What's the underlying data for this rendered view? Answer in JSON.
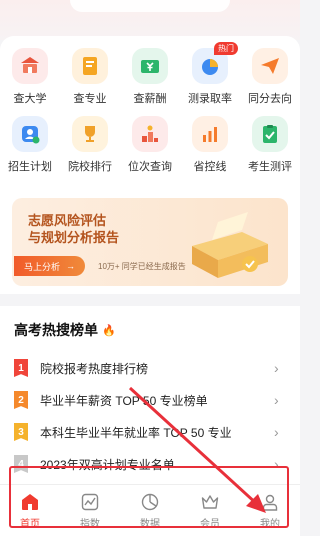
{
  "grid": [
    {
      "label": "查大学",
      "icon": "university-icon",
      "bg": "#fdeaea",
      "fg": "#e8553d"
    },
    {
      "label": "查专业",
      "icon": "book-icon",
      "bg": "#fff1dc",
      "fg": "#f5a623"
    },
    {
      "label": "查薪酬",
      "icon": "salary-icon",
      "bg": "#e4f6ec",
      "fg": "#2cb56b"
    },
    {
      "label": "测录取率",
      "icon": "pie-chart-icon",
      "bg": "#e7f0fd",
      "fg": "#3d8af0",
      "badge": "热门"
    },
    {
      "label": "同分去向",
      "icon": "paper-plane-icon",
      "bg": "#fff0e4",
      "fg": "#f57b2c"
    },
    {
      "label": "招生计划",
      "icon": "user-check-icon",
      "bg": "#e7f0fd",
      "fg": "#3d8af0"
    },
    {
      "label": "院校排行",
      "icon": "trophy-icon",
      "bg": "#fff3dd",
      "fg": "#f0a12a"
    },
    {
      "label": "位次查询",
      "icon": "position-icon",
      "bg": "#fdeaea",
      "fg": "#e8553d"
    },
    {
      "label": "省控线",
      "icon": "bar-chart-icon",
      "bg": "#fff0e4",
      "fg": "#f57b2c"
    },
    {
      "label": "考生测评",
      "icon": "clipboard-icon",
      "bg": "#e4f6ec",
      "fg": "#2cb56b"
    }
  ],
  "banner": {
    "title_line1": "志愿风险评估",
    "title_line2": "与规划分析报告",
    "button_label": "马上分析",
    "note": "10万+ 同学已经生成报告"
  },
  "hot_section": {
    "title": "高考热搜榜单",
    "items": [
      {
        "rank": "1",
        "text": "院校报考热度排行榜",
        "color": "#f0453a"
      },
      {
        "rank": "2",
        "text": "毕业半年薪资 TOP 50 专业榜单",
        "color": "#f5892c"
      },
      {
        "rank": "3",
        "text": "本科生毕业半年就业率 TOP 50 专业",
        "color": "#f5b22c"
      },
      {
        "rank": "4",
        "text": "2023年双高计划专业名单",
        "color": "#c8c8c8"
      }
    ]
  },
  "tabbar": [
    {
      "label": "首页",
      "icon": "home-icon",
      "active": true
    },
    {
      "label": "指数",
      "icon": "trend-icon",
      "active": false
    },
    {
      "label": "数据",
      "icon": "data-icon",
      "active": false
    },
    {
      "label": "会员",
      "icon": "crown-icon",
      "active": false
    },
    {
      "label": "我的",
      "icon": "profile-icon",
      "active": false
    }
  ],
  "colors": {
    "accent": "#f03a2f",
    "annotation": "#e8303a"
  }
}
